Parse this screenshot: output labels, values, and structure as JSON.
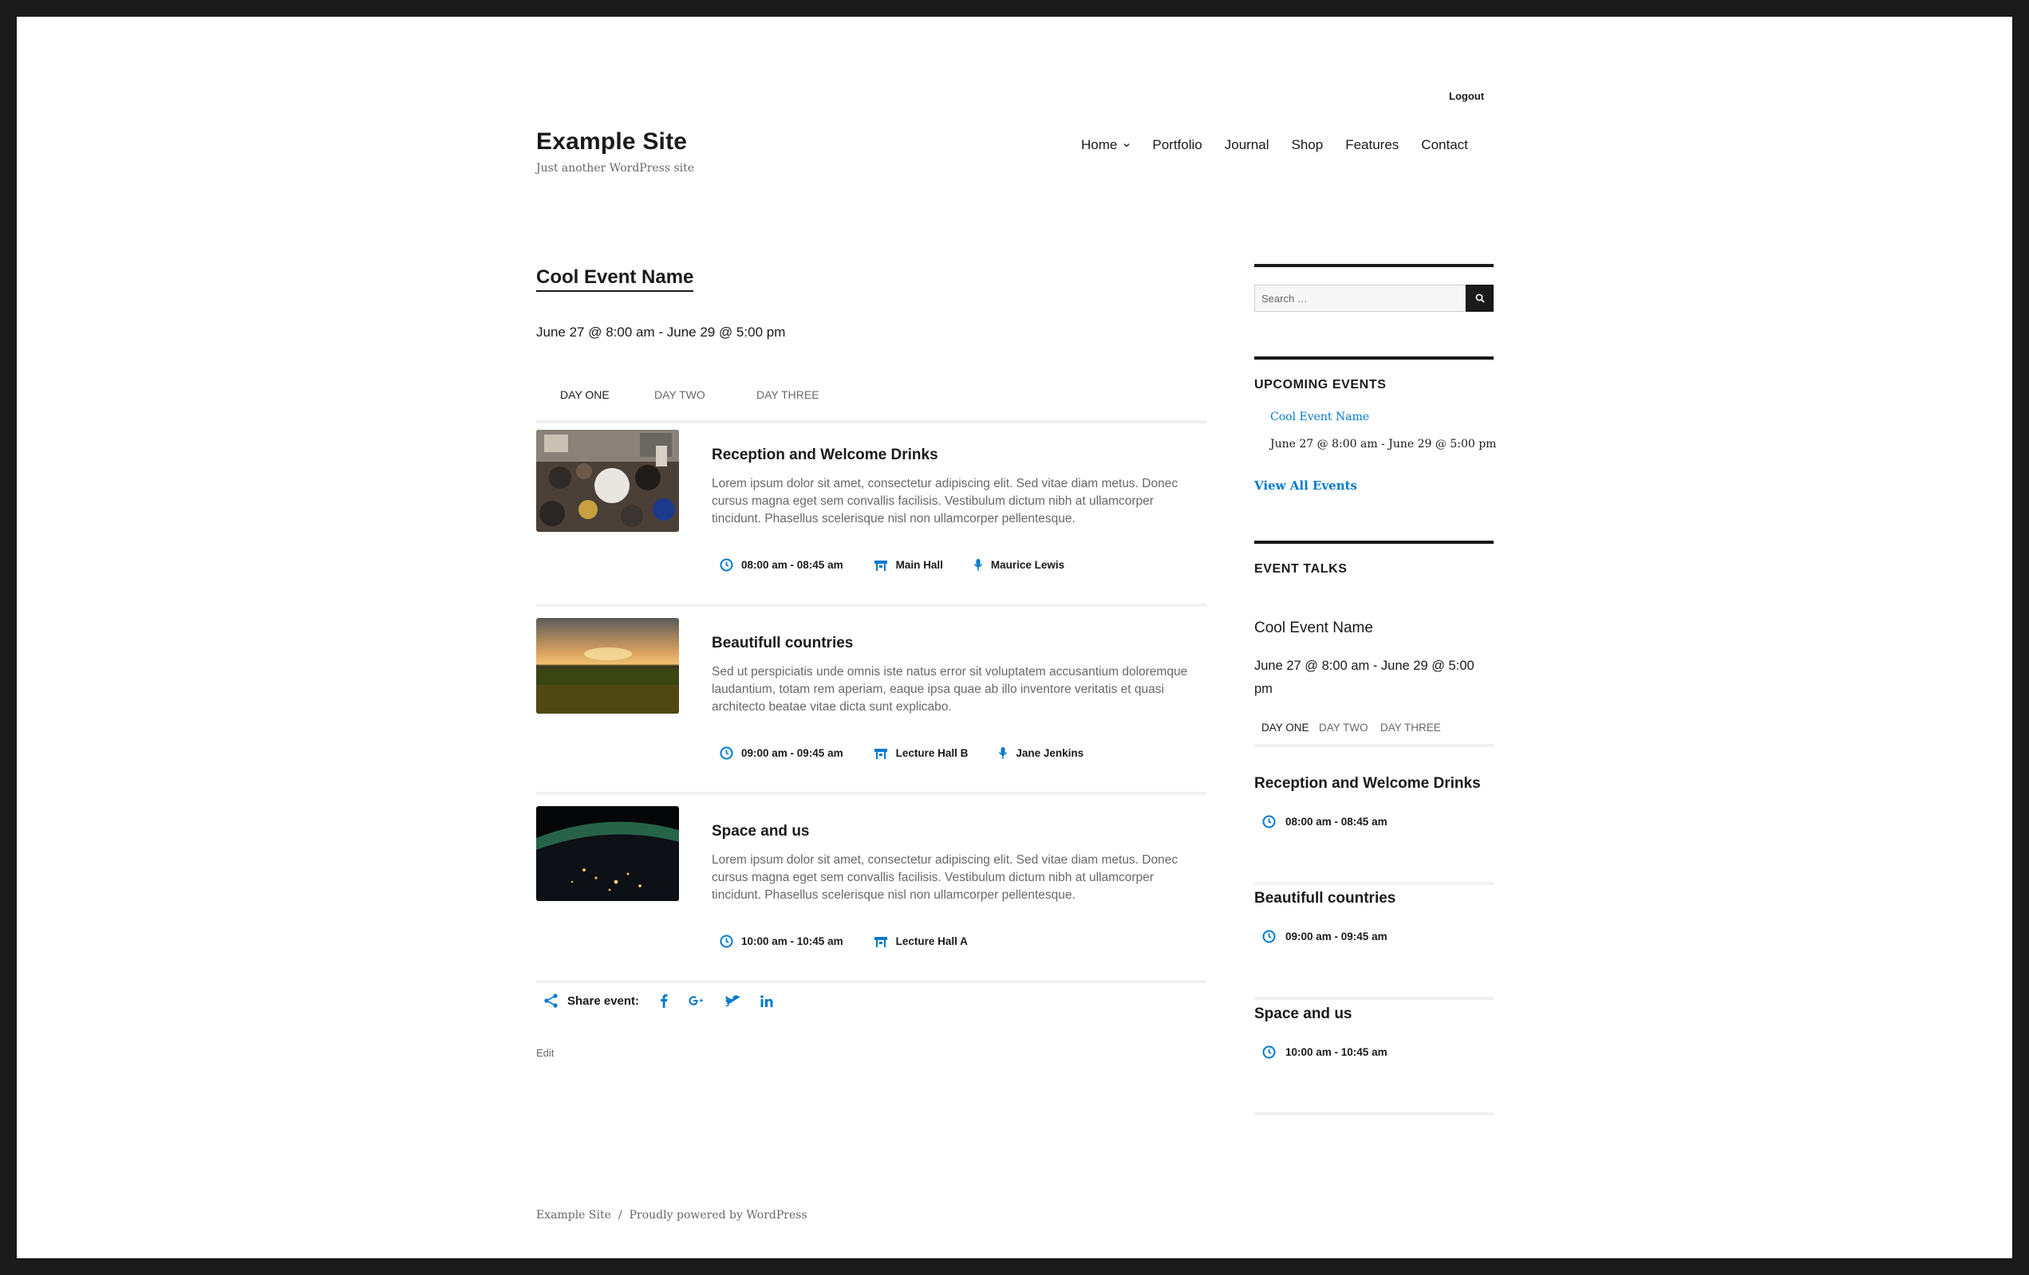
{
  "header": {
    "logout_label": "Logout",
    "site_title": "Example Site",
    "site_description": "Just another WordPress site",
    "nav": [
      "Home",
      "Portfolio",
      "Journal",
      "Shop",
      "Features",
      "Contact"
    ]
  },
  "event": {
    "title": "Cool Event Name",
    "date": "June 27 @ 8:00 am - June 29 @ 5:00 pm",
    "tabs": [
      "DAY ONE",
      "DAY TWO",
      "DAY THREE"
    ],
    "talks": [
      {
        "title": "Reception and Welcome Drinks",
        "description": "Lorem ipsum dolor sit amet, consectetur adipiscing elit. Sed vitae diam metus. Donec cursus magna eget sem convallis facilisis. Vestibulum dictum nibh at ullamcorper tincidunt. Phasellus scelerisque nisl non ullamcorper pellentesque.",
        "time": "08:00 am - 08:45 am",
        "location": "Main Hall",
        "speaker": "Maurice Lewis"
      },
      {
        "title": "Beautifull countries",
        "description": "Sed ut perspiciatis unde omnis iste natus error sit voluptatem accusantium doloremque laudantium, totam rem aperiam, eaque ipsa quae ab illo inventore veritatis et quasi architecto beatae vitae dicta sunt explicabo.",
        "time": "09:00 am - 09:45 am",
        "location": "Lecture Hall B",
        "speaker": "Jane Jenkins"
      },
      {
        "title": "Space and us",
        "description": "Lorem ipsum dolor sit amet, consectetur adipiscing elit. Sed vitae diam metus. Donec cursus magna eget sem convallis facilisis. Vestibulum dictum nibh at ullamcorper tincidunt. Phasellus scelerisque nisl non ullamcorper pellentesque.",
        "time": "10:00 am - 10:45 am",
        "location": "Lecture Hall A"
      }
    ],
    "share_label": "Share event:",
    "edit_label": "Edit"
  },
  "sidebar": {
    "search_placeholder": "Search …",
    "upcoming_heading": "UPCOMING EVENTS",
    "upcoming_event_link": "Cool Event Name",
    "upcoming_event_date": "June 27 @ 8:00 am - June 29 @ 5:00 pm",
    "view_all": "View All Events",
    "talks_heading": "EVENT TALKS",
    "talks_event_title": "Cool Event Name",
    "talks_event_date": "June 27 @ 8:00 am - June 29 @ 5:00 pm",
    "talks_tabs": [
      "DAY ONE",
      "DAY TWO",
      "DAY THREE"
    ],
    "talks": [
      {
        "title": "Reception and Welcome Drinks",
        "time": "08:00 am - 08:45 am"
      },
      {
        "title": "Beautifull countries",
        "time": "09:00 am - 09:45 am"
      },
      {
        "title": "Space and us",
        "time": "10:00 am - 10:45 am"
      }
    ]
  },
  "footer": {
    "site_link": "Example Site",
    "separator": "/",
    "powered": "Proudly powered by WordPress"
  },
  "colors": {
    "accent": "#007acc",
    "text": "#1a1a1a",
    "muted": "#686868",
    "frame": "#1a1a1a"
  },
  "icons": [
    "clock-icon",
    "location-icon",
    "microphone-icon",
    "share-icon",
    "facebook-icon",
    "google-plus-icon",
    "twitter-icon",
    "linkedin-icon",
    "search-icon",
    "chevron-down-icon"
  ]
}
